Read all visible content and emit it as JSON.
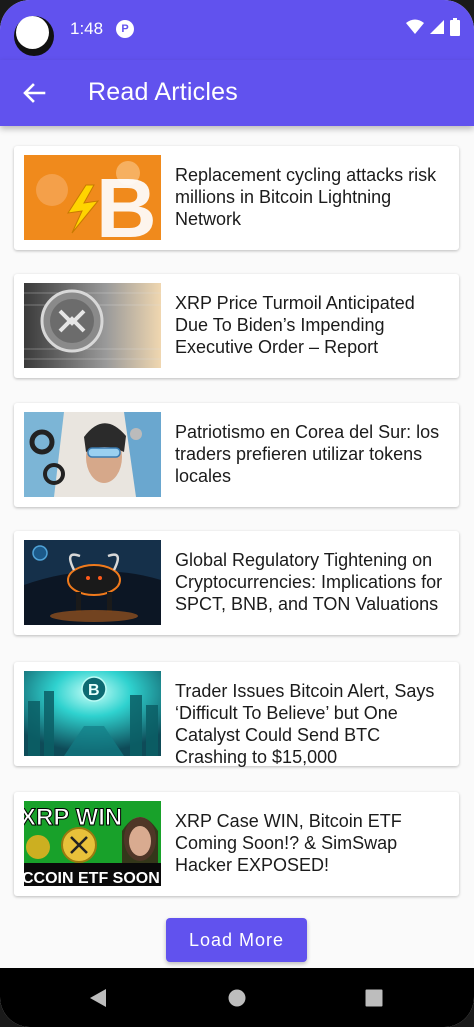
{
  "status_bar": {
    "time": "1:48",
    "app_icon": "P",
    "icons": [
      "wifi-icon",
      "signal-icon",
      "battery-icon"
    ]
  },
  "app_bar": {
    "title": "Read Articles",
    "back_icon": "arrow-left-icon"
  },
  "articles": [
    {
      "title": "Replacement cycling attacks risk millions in Bitcoin Lightning Network"
    },
    {
      "title": "XRP Price Turmoil Anticipated Due To Biden’s Impending Executive Order – Report"
    },
    {
      "title": "Patriotismo en Corea del Sur: los traders prefieren utilizar tokens locales"
    },
    {
      "title": "Global Regulatory Tightening on Cryptocurrencies: Implications for SPCT, BNB, and TON Valuations"
    },
    {
      "title": "Trader Issues Bitcoin Alert, Says ‘Difficult To Believe’ but One Catalyst Could Send BTC Crashing to $15,000"
    },
    {
      "title": "XRP Case WIN, Bitcoin ETF Coming Soon!? & SimSwap Hacker EXPOSED!"
    }
  ],
  "load_more": {
    "label": "Load More"
  },
  "nav_bar": {
    "icons": [
      "back-triangle-icon",
      "home-circle-icon",
      "recents-square-icon"
    ]
  },
  "colors": {
    "primary": "#6152ee",
    "background": "#fafafa",
    "card": "#ffffff",
    "text": "#1b1b1b"
  }
}
